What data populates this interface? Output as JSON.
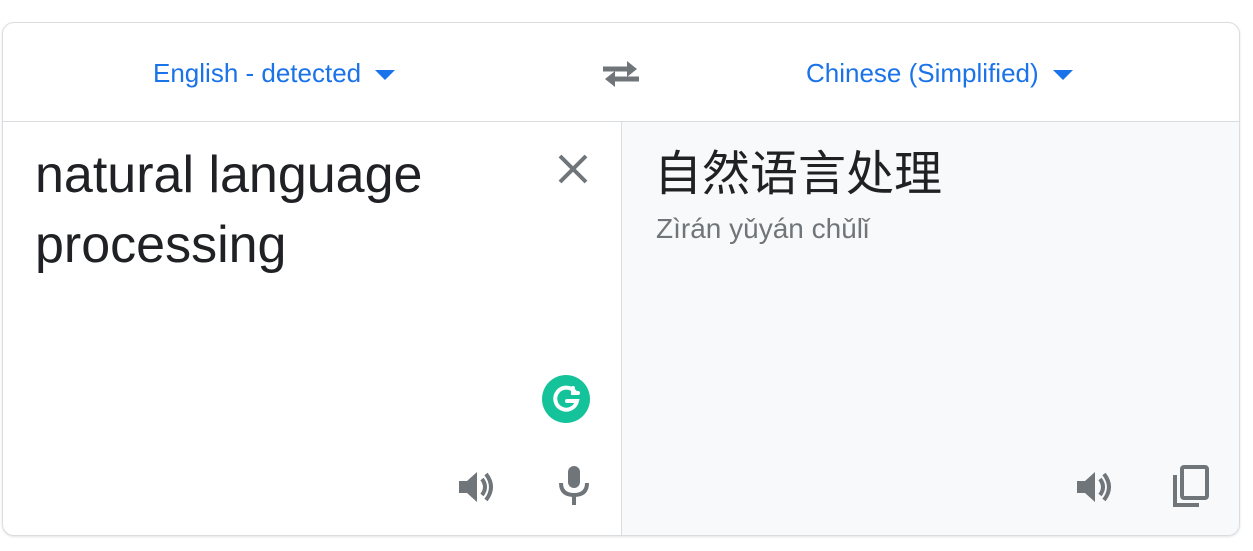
{
  "languages": {
    "source": "English - detected",
    "target": "Chinese (Simplified)"
  },
  "source": {
    "text": "natural language processing"
  },
  "target": {
    "text": "自然语言处理",
    "pinyin": "Zìrán yǔyán chǔlǐ"
  },
  "colors": {
    "accent": "#1a73e8",
    "grammarly": "#15c39a",
    "icon": "#70757a"
  },
  "icons": {
    "swap": "swap-icon",
    "clear": "close-icon",
    "grammarly": "grammarly-icon",
    "listen": "speaker-icon",
    "mic": "microphone-icon",
    "copy": "copy-icon"
  }
}
